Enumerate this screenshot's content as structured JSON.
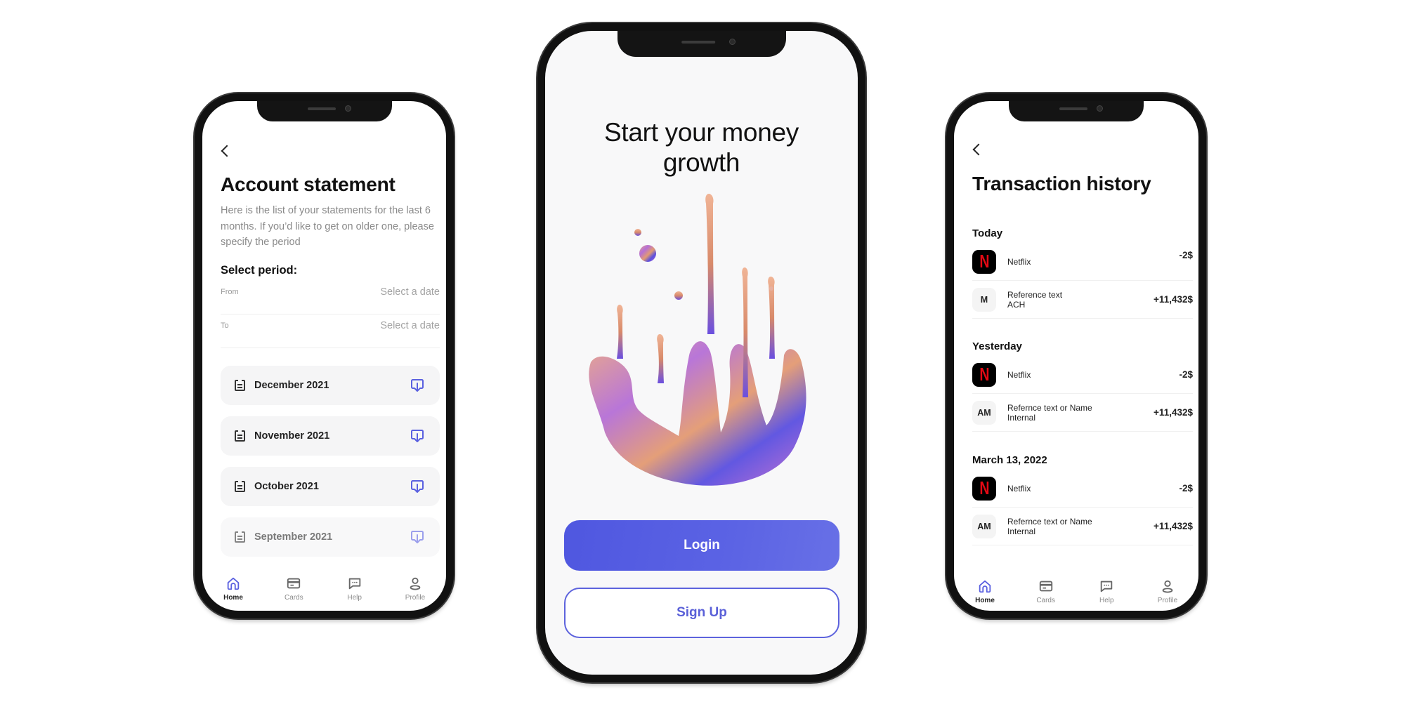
{
  "left_screen": {
    "title": "Account statement",
    "description": "Here is the list of your statements for the last 6 months. If you’d like to get on older one, please specify the period",
    "select_period_label": "Select period:",
    "fields": [
      {
        "label": "From",
        "placeholder": "Select a date"
      },
      {
        "label": "To",
        "placeholder": "Select a date"
      }
    ],
    "statements": [
      {
        "label": "December 2021",
        "icon": "document-icon",
        "action_icon": "download-icon"
      },
      {
        "label": "November 2021",
        "icon": "document-icon",
        "action_icon": "download-icon"
      },
      {
        "label": "October 2021",
        "icon": "document-icon",
        "action_icon": "download-icon"
      },
      {
        "label": "September 2021",
        "icon": "document-icon",
        "action_icon": "download-icon"
      }
    ]
  },
  "center_screen": {
    "title_line1": "Start your money",
    "title_line2": "growth",
    "illustration": "liquid-metal-splash",
    "login_label": "Login",
    "signup_label": "Sign Up"
  },
  "right_screen": {
    "title": "Transaction history",
    "groups": [
      {
        "label": "Today",
        "transactions": [
          {
            "avatar": "N",
            "avatar_type": "netflix",
            "name": "Netflix",
            "amount": "-2$"
          },
          {
            "avatar": "M",
            "avatar_type": "initials",
            "name": "Reference text",
            "name2": "ACH",
            "amount": "+11,432$"
          }
        ]
      },
      {
        "label": "Yesterday",
        "transactions": [
          {
            "avatar": "N",
            "avatar_type": "netflix",
            "name": "Netflix",
            "amount": "-2$"
          },
          {
            "avatar": "AM",
            "avatar_type": "initials",
            "name": "Refernce text or Name",
            "name2": "Internal",
            "amount": "+11,432$"
          }
        ]
      },
      {
        "label": "March 13, 2022",
        "transactions": [
          {
            "avatar": "N",
            "avatar_type": "netflix",
            "name": "Netflix",
            "amount": "-2$"
          },
          {
            "avatar": "AM",
            "avatar_type": "initials",
            "name": "Refernce text or Name",
            "name2": "Internal",
            "amount": "+11,432$"
          }
        ]
      }
    ]
  },
  "bottom_nav": {
    "items": [
      {
        "label": "Home",
        "icon": "home-icon",
        "active": true
      },
      {
        "label": "Cards",
        "icon": "card-icon",
        "active": false
      },
      {
        "label": "Help",
        "icon": "chat-icon",
        "active": false
      },
      {
        "label": "Profile",
        "icon": "profile-icon",
        "active": false
      }
    ]
  },
  "colors": {
    "accent": "#5a60e0",
    "netflix_red": "#e50914",
    "row_bg": "#f5f5f6",
    "muted_text": "#8a8a8a"
  }
}
